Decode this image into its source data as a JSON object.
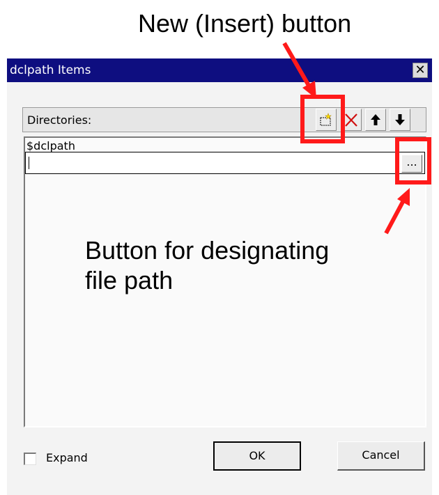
{
  "annotations": {
    "new_button_label": "New (Insert) button",
    "path_button_label_line1": "Button for designating",
    "path_button_label_line2": "file path"
  },
  "dialog": {
    "title": "dclpath Items",
    "close_glyph": "✕",
    "header_label": "Directories:",
    "toolbar": {
      "new_icon": "new-folder-icon",
      "delete_icon": "delete-x-icon",
      "up_icon": "arrow-up-icon",
      "down_icon": "arrow-down-icon"
    },
    "list_items": [
      "$dclpath"
    ],
    "edit_value": "",
    "browse_label": "...",
    "expand_label": "Expand",
    "expand_checked": false,
    "ok_label": "OK",
    "cancel_label": "Cancel"
  },
  "colors": {
    "highlight": "#ff1a1a",
    "titlebar": "#0e0e80"
  }
}
